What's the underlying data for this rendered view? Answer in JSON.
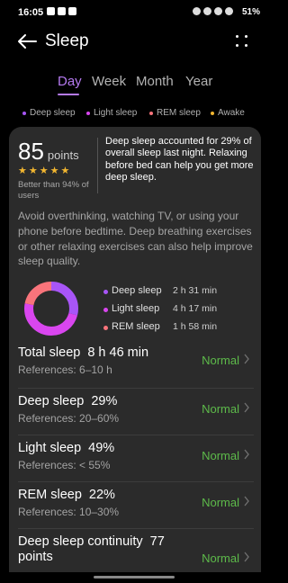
{
  "status": {
    "time": "16:05",
    "battery": "51%"
  },
  "header": {
    "title": "Sleep"
  },
  "tabs": [
    {
      "label": "Day",
      "active": true
    },
    {
      "label": "Week",
      "active": false
    },
    {
      "label": "Month",
      "active": false
    },
    {
      "label": "Year",
      "active": false
    }
  ],
  "legend": [
    {
      "label": "Deep sleep",
      "color": "#a855f7"
    },
    {
      "label": "Light sleep",
      "color": "#d946ef"
    },
    {
      "label": "REM sleep",
      "color": "#f9747b"
    },
    {
      "label": "Awake",
      "color": "#f2b630"
    }
  ],
  "score": {
    "value": "85",
    "unit": "points",
    "stars": 5,
    "better_than": "Better than 94% of users"
  },
  "summary": "Deep sleep accounted for 29% of overall sleep last night. Relaxing before bed can help you get more deep sleep.",
  "advice": "Avoid overthinking, watching TV, or using your phone before bedtime. Deep breathing exercises or other relaxing exercises can also help improve sleep quality.",
  "breakdown": [
    {
      "label": "Deep sleep",
      "value": "2 h 31 min",
      "color": "#a855f7",
      "share": 0.29
    },
    {
      "label": "Light sleep",
      "value": "4 h 17 min",
      "color": "#d946ef",
      "share": 0.49
    },
    {
      "label": "REM sleep",
      "value": "1 h 58 min",
      "color": "#f9747b",
      "share": 0.22
    }
  ],
  "metrics": [
    {
      "title": "Total sleep",
      "value": "8 h 46 min",
      "ref": "References: 6–10 h",
      "status": "Normal"
    },
    {
      "title": "Deep sleep",
      "value": "29%",
      "ref": "References: 20–60%",
      "status": "Normal"
    },
    {
      "title": "Light sleep",
      "value": "49%",
      "ref": "References: < 55%",
      "status": "Normal"
    },
    {
      "title": "REM sleep",
      "value": "22%",
      "ref": "References: 10–30%",
      "status": "Normal"
    },
    {
      "title": "Deep sleep continuity",
      "value": "77 points",
      "ref": "",
      "status": "Normal"
    }
  ]
}
